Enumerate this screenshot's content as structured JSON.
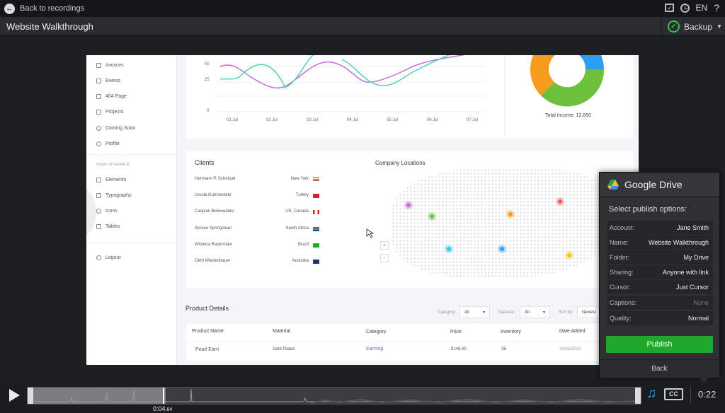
{
  "topbar": {
    "back_label": "Back to recordings",
    "lang": "EN",
    "help": "?"
  },
  "titlebar": {
    "title": "Website Walkthrough",
    "backup_label": "Backup"
  },
  "sidebar": {
    "items_top": [
      "Invoices",
      "Events",
      "404 Page",
      "Projects",
      "Coming Soon",
      "Profile"
    ],
    "section": "USER INTERFACE",
    "items_ui": [
      "Elements",
      "Typography",
      "Icons",
      "Tables"
    ],
    "logout": "Logout"
  },
  "line_chart": {
    "y_ticks": [
      "50",
      "25",
      "0"
    ],
    "x_ticks": [
      "01 Jul",
      "02 Jul",
      "03 Jul",
      "04 Jul",
      "05 Jul",
      "06 Jul",
      "07 Jul"
    ],
    "colors": {
      "series_a": "#c86bdd",
      "series_b": "#4fd6a8"
    }
  },
  "donut": {
    "label": "Total Income: 12,650",
    "colors": [
      "#f59b1e",
      "#6cc13a",
      "#2d9ff0"
    ]
  },
  "clients": {
    "title": "Clients",
    "rows": [
      {
        "name": "Hermann P. Schnitzel",
        "country": "New York",
        "flag": "us"
      },
      {
        "name": "Ursula Gurnmeister",
        "country": "Turkey",
        "flag": "tr"
      },
      {
        "name": "Caspian Bellevedere",
        "country": "US, Canada",
        "flag": "ca"
      },
      {
        "name": "Spruce Springclean",
        "country": "South Africa",
        "flag": "za"
      },
      {
        "name": "Wisteria Ravenclaw",
        "country": "Brazil",
        "flag": "br"
      },
      {
        "name": "Girth Wiedenbauer",
        "country": "Australia",
        "flag": "au"
      }
    ]
  },
  "locations": {
    "title": "Company Locations",
    "zoom_in": "+",
    "zoom_out": "-"
  },
  "products": {
    "title": "Product Details",
    "filters": {
      "category_label": "Category:",
      "category_value": "All",
      "material_label": "Material:",
      "material_value": "All",
      "sort_label": "Sort by:",
      "sort_value": "Newest"
    },
    "headers": [
      "Product Name",
      "Material",
      "Category",
      "Price",
      "Inventory",
      "Date Added"
    ],
    "row": {
      "name": "Pearl Earri",
      "material": "Gold Plated",
      "category": "Earning",
      "price": "$148.00",
      "inventory": "38",
      "date": "20/06/2016"
    }
  },
  "google_drive": {
    "title": "Google Drive",
    "subtitle": "Select publish options:",
    "options": [
      {
        "label": "Account:",
        "value": "Jane Smith"
      },
      {
        "label": "Name:",
        "value": "Website Walkthrough"
      },
      {
        "label": "Folder:",
        "value": "My Drive"
      },
      {
        "label": "Sharing:",
        "value": "Anyone with link"
      },
      {
        "label": "Cursor:",
        "value": "Just Cursor"
      },
      {
        "label": "Captions:",
        "value": "None"
      },
      {
        "label": "Quality:",
        "value": "Normal"
      }
    ],
    "publish_label": "Publish",
    "back_label": "Back"
  },
  "player": {
    "current_time": "0:04",
    "current_ms": ".64",
    "total_time": "0:22",
    "cc_label": "CC",
    "progress": 0.22
  },
  "accent": {
    "publish_green": "#1fa82a",
    "music_blue": "#2b9be0"
  }
}
